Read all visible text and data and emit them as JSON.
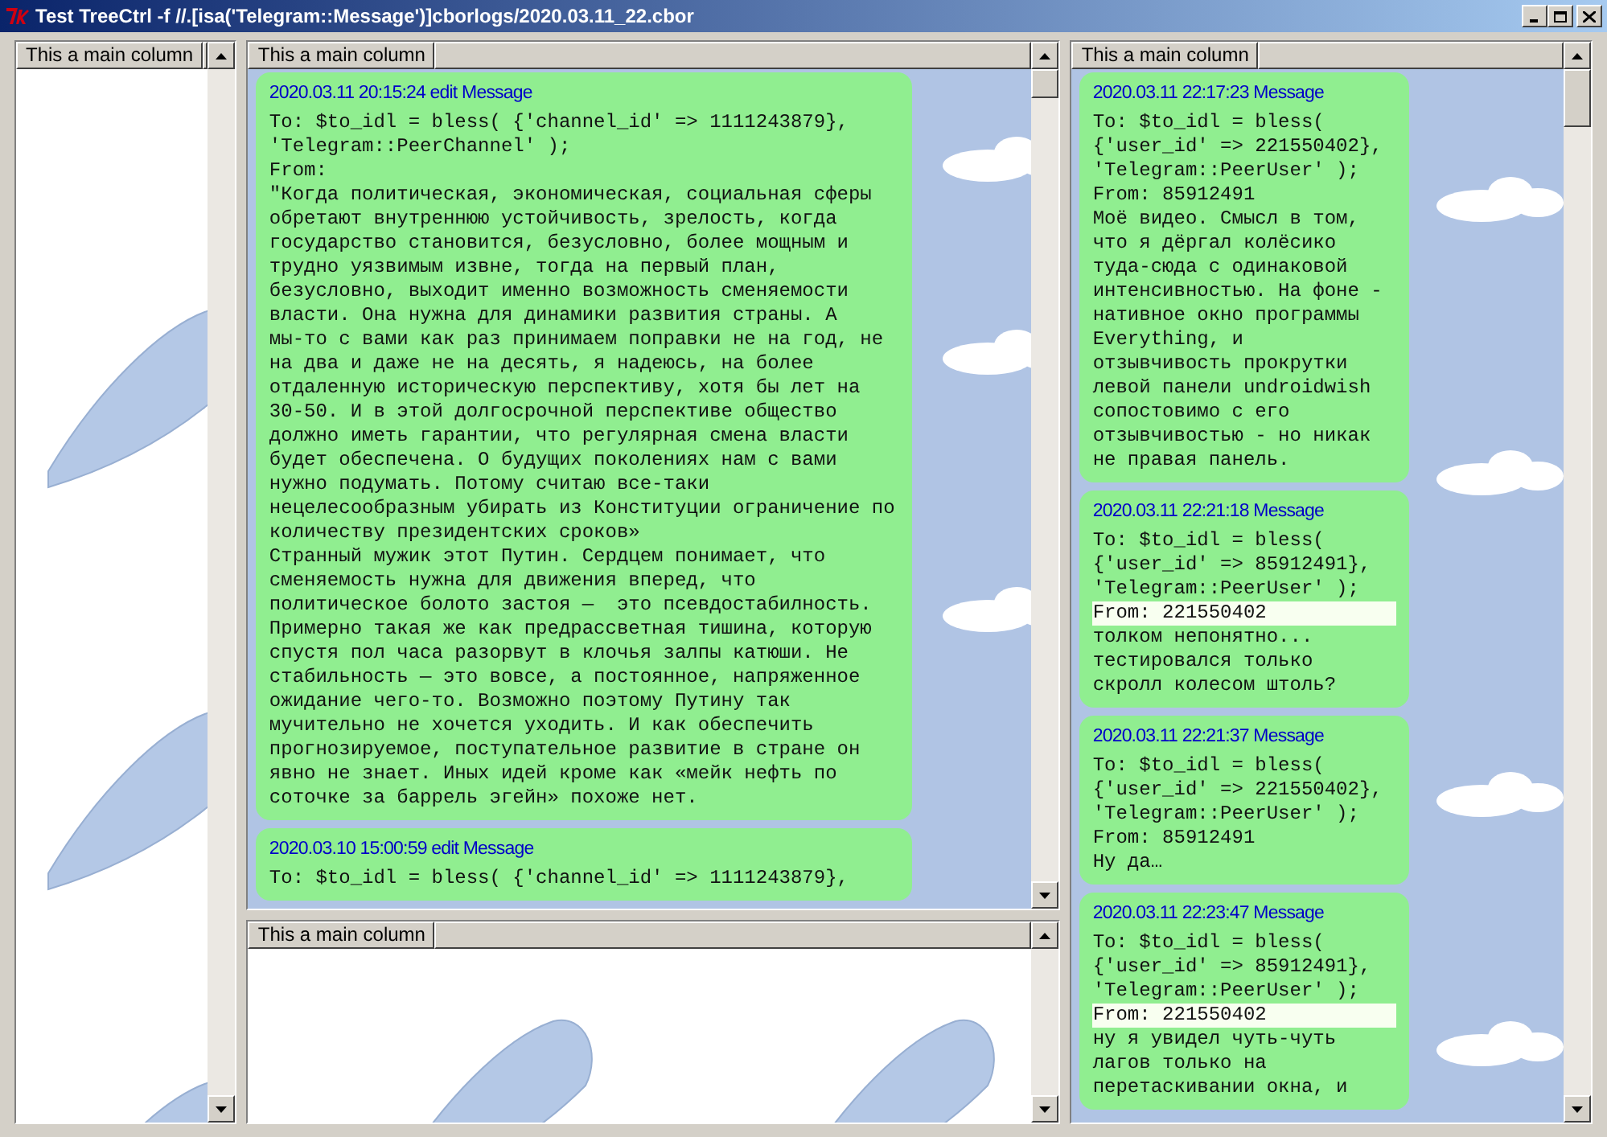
{
  "window": {
    "title": "Test TreeCtrl -f //.[isa('Telegram::Message')]cborlogs/2020.03.11_22.cbor"
  },
  "left_pane": {
    "column": "This a main column"
  },
  "top_pane": {
    "column": "This a main column",
    "messages": [
      {
        "header": "2020.03.11 20:15:24 edit Message",
        "to": [
          "To: $to_idl = bless( {'channel_id' => 1111243879},",
          "'Telegram::PeerChannel' );"
        ],
        "from": "From:",
        "from_highlighted": false,
        "body": [
          "\"Когда политическая, экономическая, социальная сферы",
          "обретают внутреннюю устойчивость, зрелость, когда",
          "государство становится, безусловно, более мощным и",
          "трудно уязвимым извне, тогда на первый план,",
          "безусловно, выходит именно возможность сменяемости",
          "власти. Она нужна для динамики развития страны. А",
          "мы-то с вами как раз принимаем поправки не на год, не",
          "на два и даже не на десять, я надеюсь, на более",
          "отдаленную историческую перспективу, хотя бы лет на",
          "30-50. И в этой долгосрочной перспективе общество",
          "должно иметь гарантии, что регулярная смена власти",
          "будет обеспечена. О будущих поколениях нам с вами",
          "нужно подумать. Потому считаю все-таки",
          "нецелесообразным убирать из Конституции ограничение по",
          "количеству президентских сроков»",
          "Странный мужик этот Путин. Сердцем понимает, что",
          "сменяемость нужна для движения вперед, что",
          "политическое болото застоя —  это псевдостабилность.",
          "Примерно такая же как предрассветная тишина, которую",
          "спустя пол часа разорвут в клочья залпы катюши. Не",
          "стабильность — это вовсе, а постоянное, напряженное",
          "ожидание чего-то. Возможно поэтому Путину так",
          "мучительно не хочется уходить. И как обеспечить",
          "прогнозируемое, поступательное развитие в стране он",
          "явно не знает. Иных идей кроме как «мейк нефть по",
          "соточке за баррель эгейн» похоже нет."
        ]
      },
      {
        "header": "2020.03.10 15:00:59 edit Message",
        "to": [
          "To: $to_idl = bless( {'channel_id' => 1111243879},"
        ]
      }
    ]
  },
  "bottom_pane": {
    "column": "This a main column"
  },
  "right_pane": {
    "column": "This a main column",
    "messages": [
      {
        "header": "2020.03.11 22:17:23 Message",
        "to": [
          "To: $to_idl = bless(",
          "{'user_id' => 221550402},",
          "'Telegram::PeerUser' );"
        ],
        "from": "From: 85912491",
        "from_highlighted": false,
        "body": [
          "Моё видео. Смысл в том,",
          "что я дёргал колёсико",
          "туда-сюда с одинаковой",
          "интенсивностью. На фоне -",
          "нативное окно программы",
          "Everything, и",
          "отзывчивость прокрутки",
          "левой панели undroidwish",
          "сопостовимо с его",
          "отзывчивостью - но никак",
          "не правая панель."
        ]
      },
      {
        "header": "2020.03.11 22:21:18 Message",
        "to": [
          "To: $to_idl = bless(",
          "{'user_id' => 85912491},",
          "'Telegram::PeerUser' );"
        ],
        "from": "From: 221550402",
        "from_highlighted": true,
        "body": [
          "толком непонятно...",
          "тестировался только",
          "скролл колесом штоль?"
        ]
      },
      {
        "header": "2020.03.11 22:21:37 Message",
        "to": [
          "To: $to_idl = bless(",
          "{'user_id' => 221550402},",
          "'Telegram::PeerUser' );"
        ],
        "from": "From: 85912491",
        "from_highlighted": false,
        "body": [
          "Ну да…"
        ]
      },
      {
        "header": "2020.03.11 22:23:47 Message",
        "to": [
          "To: $to_idl = bless(",
          "{'user_id' => 85912491},",
          "'Telegram::PeerUser' );"
        ],
        "from": "From: 221550402",
        "from_highlighted": true,
        "body": [
          "ну я увидел чуть-чуть",
          "лагов только на",
          "перетаскивании окна, и"
        ]
      }
    ]
  }
}
